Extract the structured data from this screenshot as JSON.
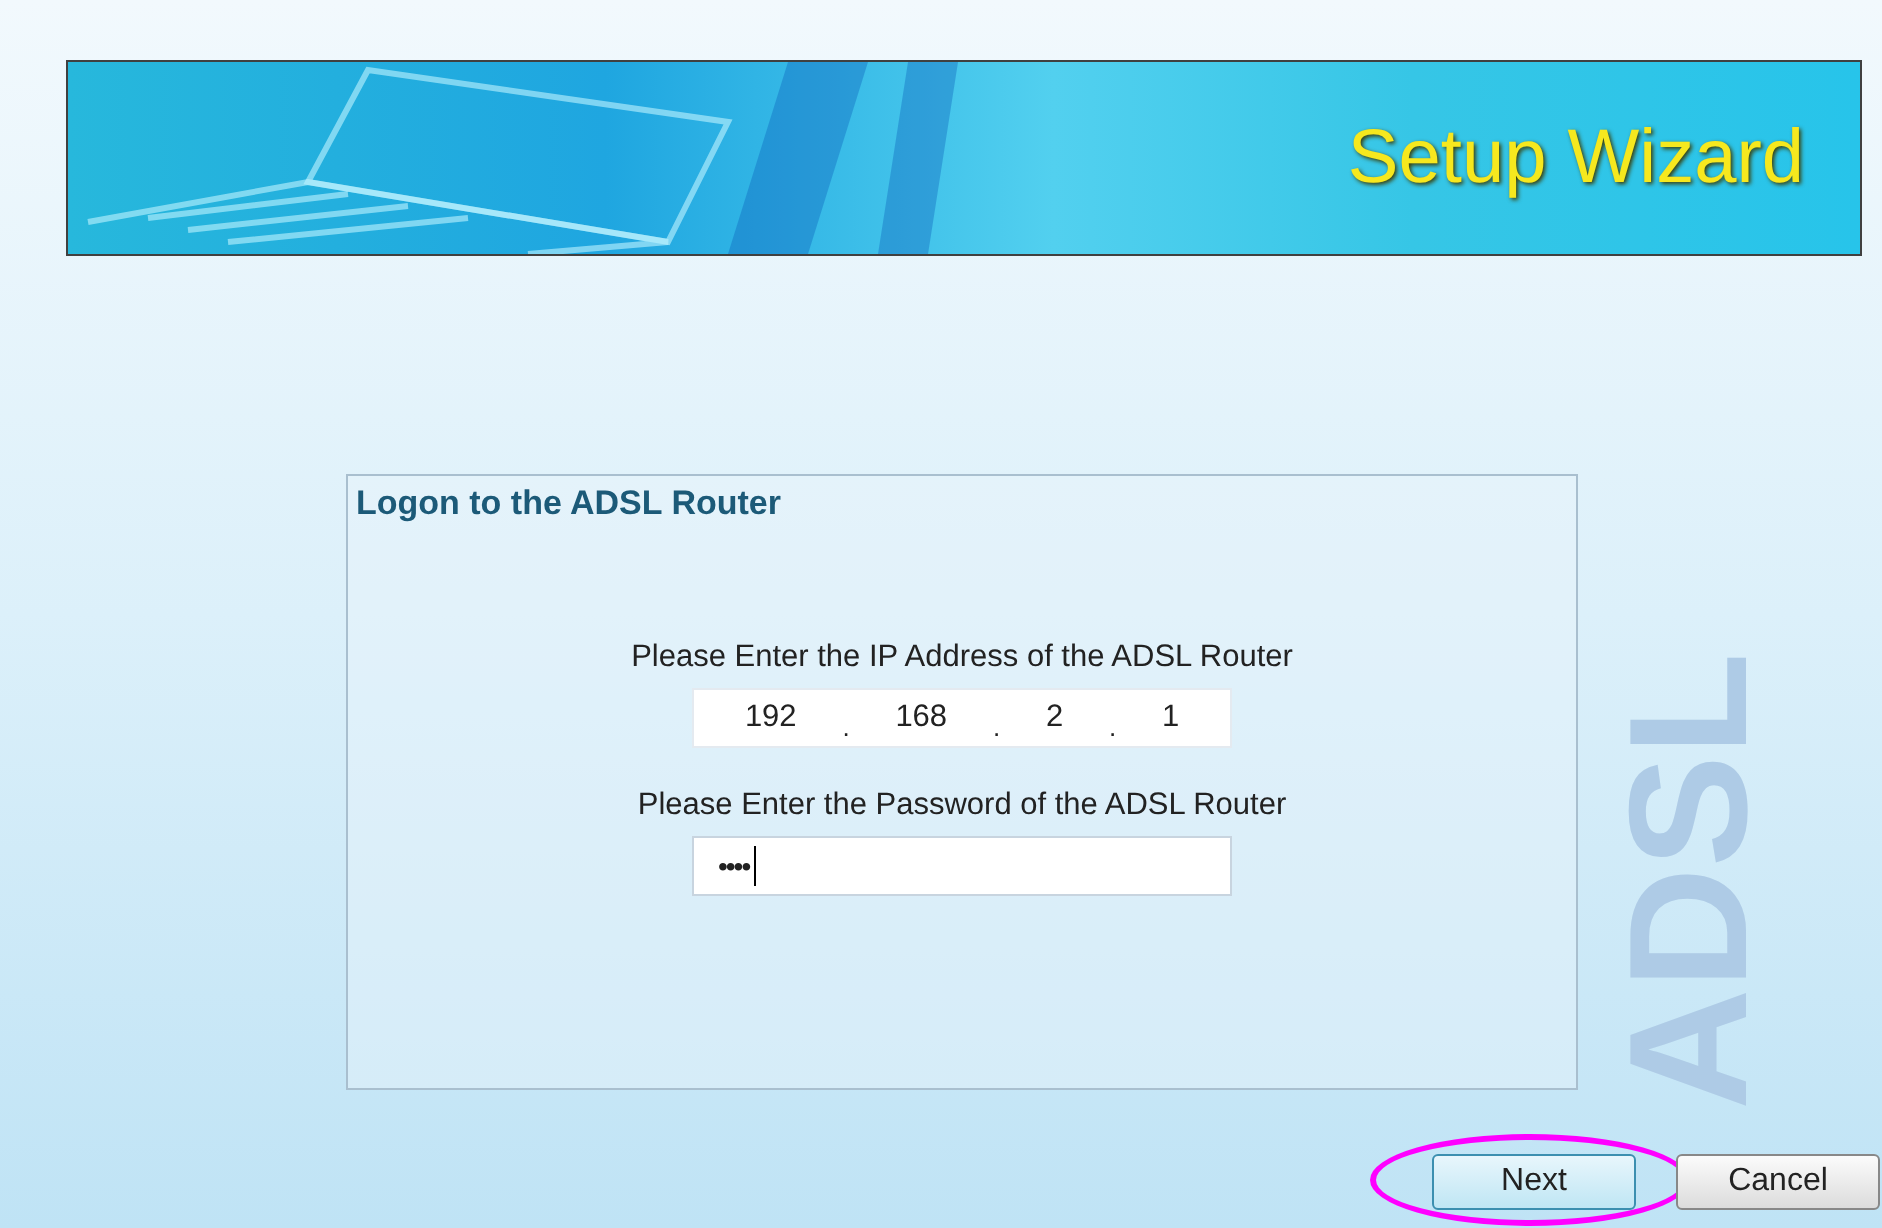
{
  "banner": {
    "title": "Setup Wizard"
  },
  "background_art": {
    "text": "ADSL"
  },
  "panel": {
    "title": "Logon to the ADSL Router",
    "ip_label": "Please Enter the IP Address of the ADSL Router",
    "ip_address": {
      "octets": [
        "192",
        "168",
        "2",
        "1"
      ],
      "separators": [
        ".",
        ".",
        "."
      ]
    },
    "password_label": "Please Enter the Password of the ADSL Router",
    "password": {
      "value": "••••",
      "focused": true
    }
  },
  "buttons": [
    {
      "label": "Next",
      "kind": "primary",
      "highlighted": true
    },
    {
      "label": "Cancel",
      "kind": "secondary",
      "highlighted": false
    }
  ]
}
